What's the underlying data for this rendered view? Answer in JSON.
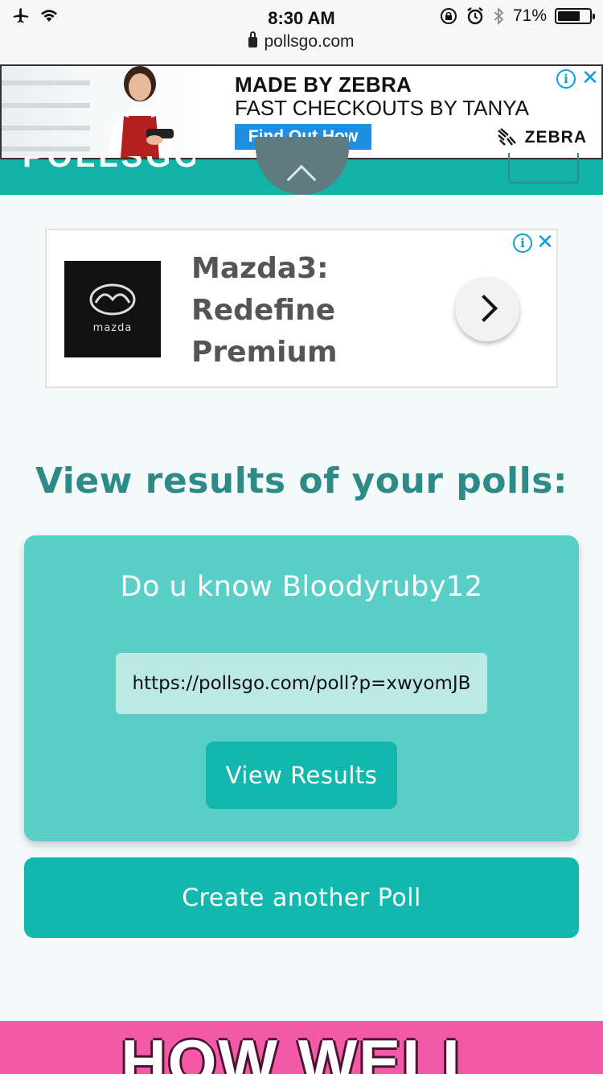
{
  "status_bar": {
    "time": "8:30 AM",
    "battery_percent": "71%",
    "battery_level": 0.71,
    "icons": [
      "airplane-icon",
      "wifi-icon",
      "orientation-lock-icon",
      "alarm-icon",
      "bluetooth-icon",
      "battery-icon"
    ]
  },
  "browser": {
    "url": "pollsgo.com"
  },
  "top_ad": {
    "headline": "MADE BY ZEBRA",
    "subheadline": "FAST CHECKOUTS BY TANYA",
    "cta": "Find Out How",
    "brand": "ZEBRA",
    "cta_color": "#1f8fe0"
  },
  "header": {
    "brand_color": "#12b2a6"
  },
  "mazda_ad": {
    "headline": "Mazda3: Redefine Premium",
    "logo_wordmark": "mazda"
  },
  "main": {
    "section_title": "View results of your polls:",
    "poll": {
      "title": "Do u know Bloodyruby12",
      "link": "https://pollsgo.com/poll?p=xwyomJB",
      "view_button": "View Results"
    },
    "create_button": "Create another Poll"
  },
  "bottom_banner": {
    "text": "HOW WELL"
  },
  "colors": {
    "accent": "#12b8ae",
    "card": "#59cfc8",
    "title": "#2e8a86",
    "pink": "#f25aa6"
  }
}
